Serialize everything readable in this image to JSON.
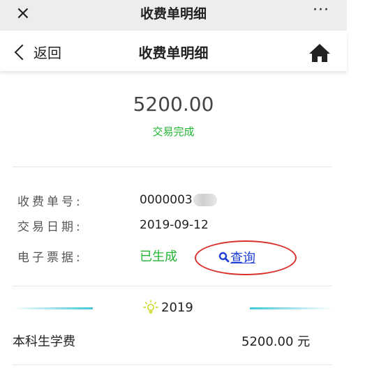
{
  "wechat_bar": {
    "close": "×",
    "title": "收费单明细",
    "more": "···"
  },
  "nav": {
    "back_label": "返回",
    "title": "收费单明细",
    "home_icon": "home-icon"
  },
  "summary": {
    "amount": "5200.00",
    "status": "交易完成",
    "status_color": "#21b534"
  },
  "details": {
    "receipt_no": {
      "label": "收费单号:",
      "value": "0000003"
    },
    "trade_date": {
      "label": "交易日期:",
      "value": "2019-09-12"
    },
    "e_invoice": {
      "label": "电子票据:",
      "value": "已生成",
      "query_label": "查询"
    }
  },
  "section": {
    "year": "2019",
    "icon": "lightbulb-icon"
  },
  "items": [
    {
      "name": "本科生学费",
      "amount": "5200.00 元"
    }
  ]
}
